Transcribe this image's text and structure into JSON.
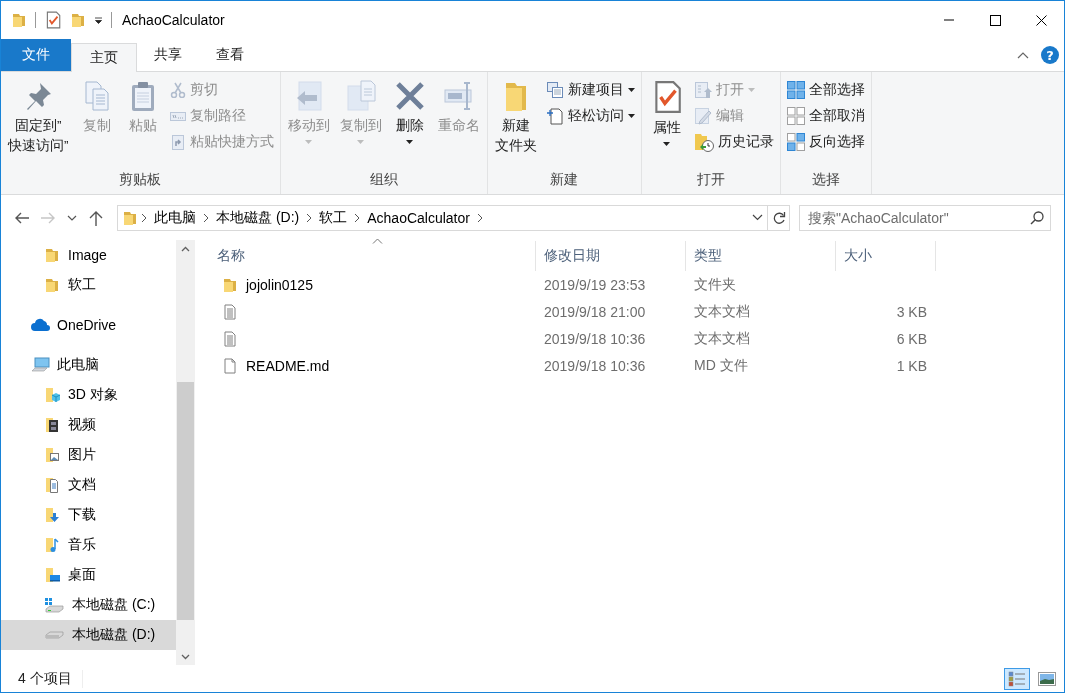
{
  "window": {
    "title": "AchaoCalculator",
    "help": "?"
  },
  "ribbon_tabs": [
    {
      "label": "文件",
      "kind": "backstage",
      "selected": false
    },
    {
      "label": "主页",
      "kind": "tab",
      "selected": true
    },
    {
      "label": "共享",
      "kind": "tab",
      "selected": false
    },
    {
      "label": "查看",
      "kind": "tab",
      "selected": false
    }
  ],
  "ribbon_groups": [
    {
      "label": "剪贴板",
      "commands": [
        {
          "label": [
            "固定到”",
            "快速访问”"
          ],
          "kind": "large",
          "disabled": false,
          "dropdown": false
        },
        {
          "label": "复制",
          "kind": "large",
          "disabled": true,
          "dropdown": false
        },
        {
          "label": "粘贴",
          "kind": "large",
          "disabled": true,
          "dropdown": false
        },
        {
          "label": "剪切",
          "kind": "small",
          "disabled": true,
          "dropdown": false
        },
        {
          "label": "复制路径",
          "kind": "small",
          "disabled": true,
          "dropdown": false
        },
        {
          "label": "粘贴快捷方式",
          "kind": "small",
          "disabled": true,
          "dropdown": false
        }
      ]
    },
    {
      "label": "组织",
      "commands": [
        {
          "label": "移动到",
          "kind": "large",
          "disabled": true,
          "dropdown": true
        },
        {
          "label": "复制到",
          "kind": "large",
          "disabled": true,
          "dropdown": true
        },
        {
          "label": "删除",
          "kind": "large",
          "disabled": false,
          "dropdown": true
        },
        {
          "label": "重命名",
          "kind": "large",
          "disabled": true,
          "dropdown": false
        }
      ]
    },
    {
      "label": "新建",
      "commands": [
        {
          "label": [
            "新建",
            "文件夹"
          ],
          "kind": "large",
          "disabled": false,
          "dropdown": false
        },
        {
          "label": "新建项目",
          "kind": "small",
          "disabled": false,
          "dropdown": true
        },
        {
          "label": "轻松访问",
          "kind": "small",
          "disabled": false,
          "dropdown": true
        }
      ]
    },
    {
      "label": "打开",
      "commands": [
        {
          "label": "属性",
          "kind": "large",
          "disabled": false,
          "dropdown": true
        },
        {
          "label": "打开",
          "kind": "small",
          "disabled": true,
          "dropdown": true
        },
        {
          "label": "编辑",
          "kind": "small",
          "disabled": true,
          "dropdown": false
        },
        {
          "label": "历史记录",
          "kind": "small",
          "disabled": false,
          "dropdown": false
        }
      ]
    },
    {
      "label": "选择",
      "commands": [
        {
          "label": "全部选择",
          "kind": "small",
          "disabled": false,
          "dropdown": false
        },
        {
          "label": "全部取消",
          "kind": "small",
          "disabled": false,
          "dropdown": false
        },
        {
          "label": "反向选择",
          "kind": "small",
          "disabled": false,
          "dropdown": false
        }
      ]
    }
  ],
  "address_bar": {
    "history_buttons": [
      {
        "kind": "back",
        "disabled": false
      },
      {
        "kind": "forward",
        "disabled": true
      }
    ],
    "breadcrumbs": [
      "此电脑",
      "本地磁盘 (D:)",
      "软工",
      "AchaoCalculator"
    ],
    "search_placeholder": "搜索\"AchaoCalculator\""
  },
  "navigation": {
    "pinned": [
      {
        "label": "Image",
        "selected": false
      },
      {
        "label": "软工",
        "selected": false
      }
    ],
    "tree": [
      {
        "label": "OneDrive",
        "selected": false
      },
      {
        "label": "此电脑",
        "selected": false,
        "children": [
          {
            "label": "3D 对象",
            "selected": false
          },
          {
            "label": "视频",
            "selected": false
          },
          {
            "label": "图片",
            "selected": false
          },
          {
            "label": "文档",
            "selected": false
          },
          {
            "label": "下载",
            "selected": false
          },
          {
            "label": "音乐",
            "selected": false
          },
          {
            "label": "桌面",
            "selected": false
          },
          {
            "label": "本地磁盘 (C:)",
            "selected": false
          },
          {
            "label": "本地磁盘 (D:)",
            "selected": true
          }
        ]
      }
    ]
  },
  "file_list": {
    "columns": [
      {
        "label": "名称",
        "sorted": true
      },
      {
        "label": "修改日期",
        "sorted": false
      },
      {
        "label": "类型",
        "sorted": false
      },
      {
        "label": "大小",
        "sorted": false
      }
    ],
    "rows": [
      {
        "kind": "folder",
        "name": "jojolin0125",
        "modified": "2019/9/19 23:53",
        "type": "文件夹"
      },
      {
        "kind": "text",
        "modified": "2019/9/18 21:00",
        "type": "文本文档",
        "size": "3 KB"
      },
      {
        "kind": "text",
        "modified": "2019/9/18 10:36",
        "type": "文本文档",
        "size": "6 KB"
      },
      {
        "kind": "file",
        "name": "README.md",
        "modified": "2019/9/18 10:36",
        "type": "MD 文件",
        "size": "1 KB"
      }
    ]
  },
  "status_bar": {
    "item_count": "4 个项目",
    "views": [
      {
        "selected": true
      },
      {
        "selected": false
      }
    ]
  }
}
